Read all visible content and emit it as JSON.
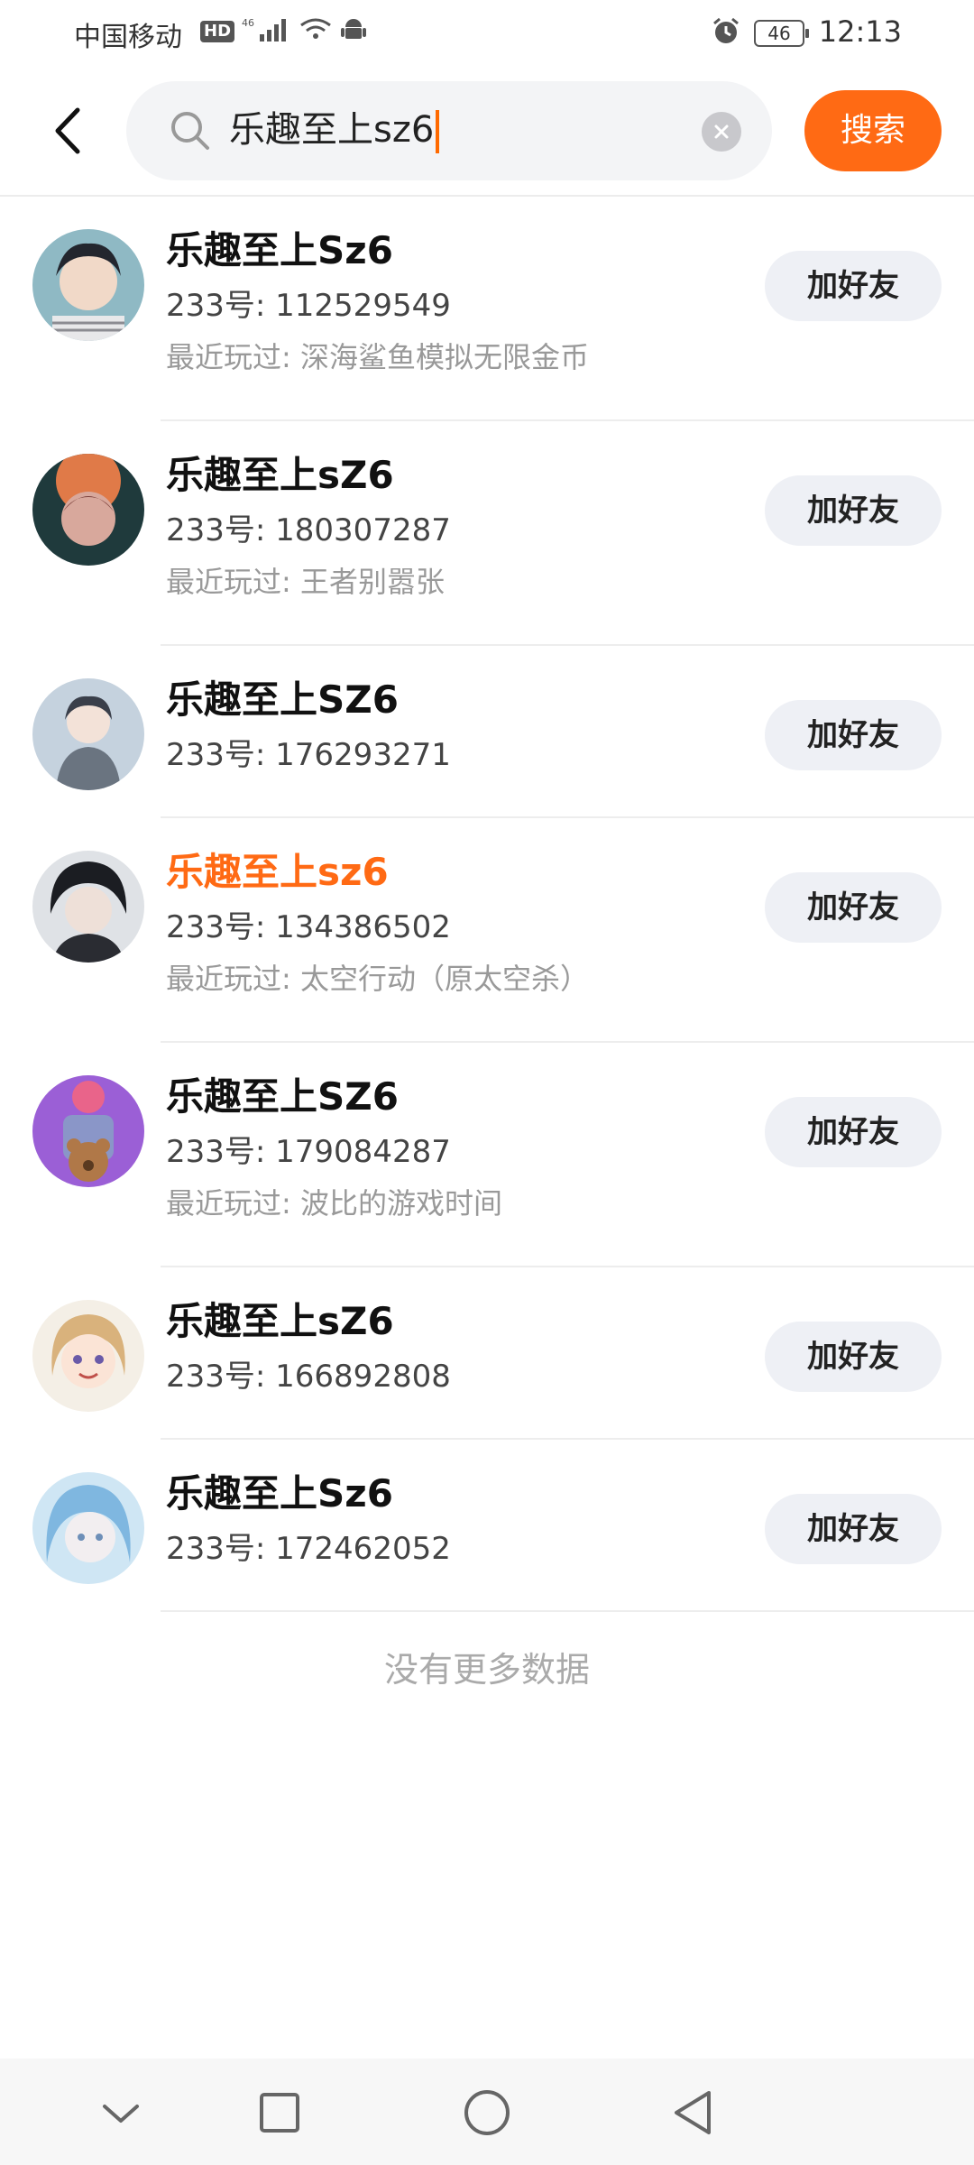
{
  "status_bar": {
    "carrier": "中国移动",
    "hd": "HD",
    "network": "46",
    "battery": "46",
    "time": "12:13"
  },
  "search": {
    "query": "乐趣至上sz6",
    "button_label": "搜索"
  },
  "results": [
    {
      "name": "乐趣至上Sz6",
      "id": "233号: 112529549",
      "recent": "最近玩过: 深海鲨鱼模拟无限金币",
      "add_label": "加好友",
      "highlight": false
    },
    {
      "name": "乐趣至上sZ6",
      "id": "233号: 180307287",
      "recent": "最近玩过: 王者别嚣张",
      "add_label": "加好友",
      "highlight": false
    },
    {
      "name": "乐趣至上SZ6",
      "id": "233号: 176293271",
      "recent": "",
      "add_label": "加好友",
      "highlight": false
    },
    {
      "name": "乐趣至上sz6",
      "id": "233号: 134386502",
      "recent": "最近玩过: 太空行动（原太空杀）",
      "add_label": "加好友",
      "highlight": true
    },
    {
      "name": "乐趣至上SZ6",
      "id": "233号: 179084287",
      "recent": "最近玩过: 波比的游戏时间",
      "add_label": "加好友",
      "highlight": false
    },
    {
      "name": "乐趣至上sZ6",
      "id": "233号: 166892808",
      "recent": "",
      "add_label": "加好友",
      "highlight": false
    },
    {
      "name": "乐趣至上Sz6",
      "id": "233号: 172462052",
      "recent": "",
      "add_label": "加好友",
      "highlight": false
    }
  ],
  "footer_text": "没有更多数据",
  "colors": {
    "accent": "#ff6a14",
    "highlight_name": "#ff6a14"
  },
  "nav": [
    "chevron-down-icon",
    "square-icon",
    "circle-icon",
    "back-triangle-icon"
  ]
}
